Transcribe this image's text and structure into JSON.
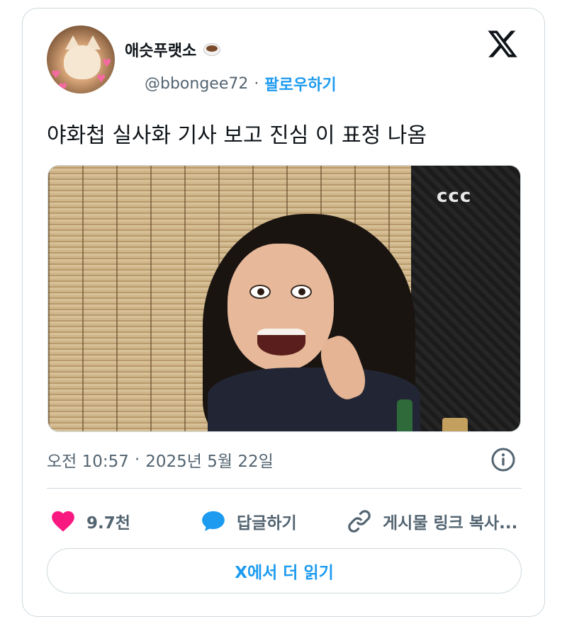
{
  "tweet": {
    "author": {
      "display_name": "애슷푸랫소",
      "name_emoji": "coffee-cup-icon",
      "handle": "@bbongee72",
      "separator": "·",
      "follow_label": "팔로우하기"
    },
    "text": "야화첩 실사화 기사 보고 진심 이 표정 나옴",
    "media": {
      "type": "photo",
      "panel_logo": "ccc"
    },
    "timestamp": {
      "time": "오전 10:57",
      "separator": "·",
      "date": "2025년 5월 22일"
    },
    "actions": {
      "like_count": "9.7천",
      "reply_label": "답글하기",
      "copy_link_label": "게시물 링크 복사..."
    },
    "read_more_label": "X에서 더 읽기"
  },
  "colors": {
    "accent": "#1d9bf0",
    "like": "#f91880",
    "secondary_text": "#536471",
    "border": "#cfd9de"
  }
}
